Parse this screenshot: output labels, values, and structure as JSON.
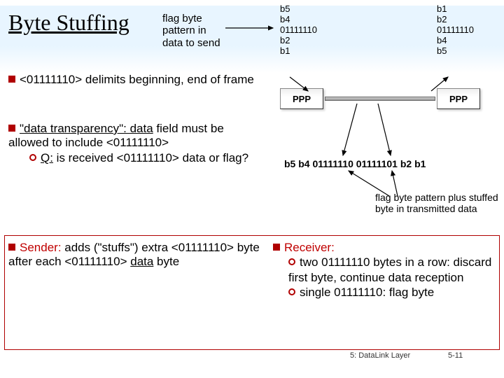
{
  "title": "Byte Stuffing",
  "flag_label": "flag byte pattern in data to send",
  "bullets": {
    "b1": "<01111110> delimits beginning, end of frame",
    "b2_lead": "\"data transparency\": data",
    "b2_rest": " field must be allowed to include  <01111110>",
    "b2_q": "Q:",
    "b2_q_rest": " is received <01111110> data or flag?",
    "b3_lead": "Sender:",
    "b3_rest": " adds (\"stuffs\") extra <01111110> byte after each <01111110> ",
    "b3_data": "data",
    "b3_tail": "  byte",
    "b4_lead": "Receiver:",
    "b4_s1": "two 01111110 bytes in a row: discard first byte, continue data reception",
    "b4_s2": "single 01111110: flag byte"
  },
  "diagram": {
    "left_col": [
      "b5",
      "b4",
      "01111110",
      "b2",
      "b1"
    ],
    "right_col": [
      "b1",
      "b2",
      "01111110",
      "b4",
      "b5"
    ],
    "ppp": "PPP",
    "stream": "b5 b4 01111110 01111101 b2 b1"
  },
  "after_label": "flag byte pattern plus stuffed byte in transmitted  data",
  "footer": "5: DataLink Layer",
  "pagenum": "5-11"
}
